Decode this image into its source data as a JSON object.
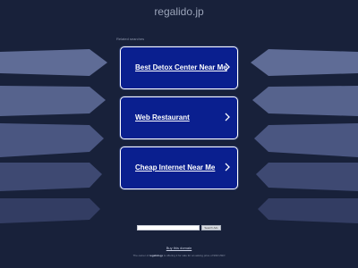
{
  "site": {
    "title": "regalido.jp"
  },
  "related": {
    "label": "Related searches",
    "links": [
      {
        "label": "Best Detox Center Near Me"
      },
      {
        "label": "Web Restaurant"
      },
      {
        "label": "Cheap Internet Near Me"
      }
    ]
  },
  "search": {
    "placeholder": "",
    "button_label": "Search Ads"
  },
  "footer": {
    "buy_label": "Buy this domain",
    "owner_prefix": "The owner of",
    "owner_domain": "regalido.jp",
    "owner_suffix": "is offering it for sale for an asking price of 999 USD!"
  },
  "colors": {
    "background": "#18213a",
    "card": "#0a1f8f",
    "shape": "#5b6994"
  }
}
